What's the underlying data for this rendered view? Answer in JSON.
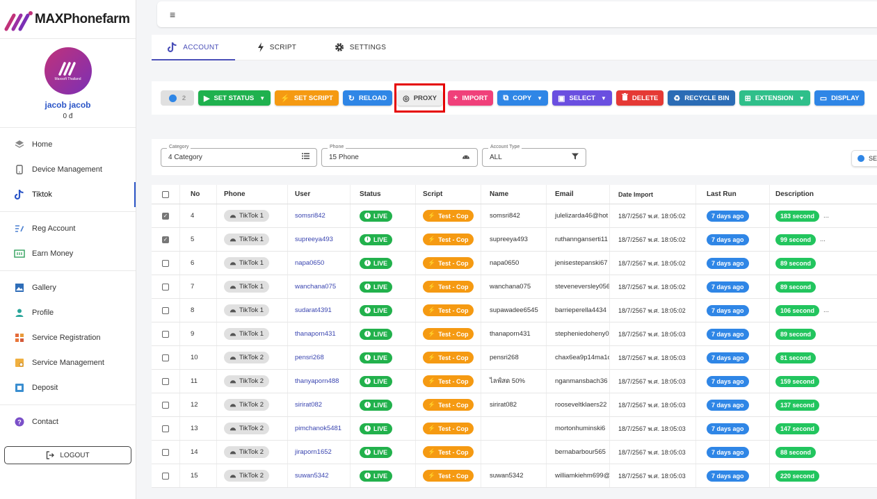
{
  "brand": {
    "name_prefix": "MAX",
    "name_suffix": "Phonefarm"
  },
  "profile": {
    "avatar_caption": "Maxsoft Thailand",
    "username": "jacob jacob",
    "balance": "0 đ"
  },
  "nav": {
    "groups": [
      [
        {
          "label": "Home",
          "icon": "layers-icon"
        },
        {
          "label": "Device Management",
          "icon": "device-icon"
        },
        {
          "label": "Tiktok",
          "icon": "tiktok-icon",
          "active": true
        }
      ],
      [
        {
          "label": "Reg Account",
          "icon": "reg-icon"
        },
        {
          "label": "Earn Money",
          "icon": "money-icon"
        }
      ],
      [
        {
          "label": "Gallery",
          "icon": "gallery-icon"
        },
        {
          "label": "Profile",
          "icon": "person-icon"
        },
        {
          "label": "Service Registration",
          "icon": "grid-icon"
        },
        {
          "label": "Service Management",
          "icon": "manage-icon"
        },
        {
          "label": "Deposit",
          "icon": "deposit-icon"
        }
      ],
      [
        {
          "label": "Contact",
          "icon": "help-icon"
        }
      ]
    ],
    "logout": "LOGOUT"
  },
  "topbar": {
    "menu_icon": "≡"
  },
  "tabs": [
    {
      "label": "ACCOUNT",
      "icon": "tiktok-icon"
    },
    {
      "label": "SCRIPT",
      "icon": "bolt-icon"
    },
    {
      "label": "SETTINGS",
      "icon": "gear-icon"
    }
  ],
  "toolbar": {
    "toggle_count": "2",
    "buttons": [
      {
        "label": "SET STATUS",
        "color": "#1fb14e",
        "icon": "▶",
        "caret": true
      },
      {
        "label": "SET SCRIPT",
        "color": "#f59a12",
        "icon": "⚡",
        "caret": false
      },
      {
        "label": "RELOAD",
        "color": "#2f86e6",
        "icon": "↻",
        "caret": false
      },
      {
        "label": "PROXY",
        "color": "#eeeeee",
        "icon": "◎",
        "caret": false
      },
      {
        "label": "IMPORT",
        "color": "#f0407a",
        "icon": "+",
        "caret": false
      },
      {
        "label": "COPY",
        "color": "#2f86e6",
        "icon": "⧉",
        "caret": true
      },
      {
        "label": "SELECT",
        "color": "#6a4fe0",
        "icon": "▣",
        "caret": true
      },
      {
        "label": "DELETE",
        "color": "#e53935",
        "icon": "🗑",
        "caret": false
      },
      {
        "label": "RECYCLE BIN",
        "color": "#2b6cb5",
        "icon": "♻",
        "caret": false
      },
      {
        "label": "EXTENSION",
        "color": "#2fbf8a",
        "icon": "⊞",
        "caret": true
      },
      {
        "label": "DISPLAY",
        "color": "#2f86e6",
        "icon": "▭",
        "caret": false
      }
    ]
  },
  "filters": {
    "category": {
      "label": "Category",
      "value": "4 Category"
    },
    "phone": {
      "label": "Phone",
      "value": "15 Phone"
    },
    "account_type": {
      "label": "Account Type",
      "value": "ALL"
    },
    "search_label": "SE"
  },
  "table": {
    "headers": [
      "No",
      "Phone",
      "User",
      "Status",
      "Script",
      "Name",
      "Email",
      "Date Import",
      "Last Run",
      "Description"
    ],
    "rows": [
      {
        "checked": true,
        "no": "4",
        "phone": "TikTok 1",
        "user": "somsri842",
        "status": "LIVE",
        "script": "Test - Cop",
        "name": "somsri842",
        "email": "julelizarda46@hot",
        "date": "18/7/2567 พ.ศ. 18:05:02",
        "last": "7 days ago",
        "desc": "183 second",
        "more": "..."
      },
      {
        "checked": true,
        "no": "5",
        "phone": "TikTok 1",
        "user": "supreeya493",
        "status": "LIVE",
        "script": "Test - Cop",
        "name": "supreeya493",
        "email": "ruthannganserti11",
        "date": "18/7/2567 พ.ศ. 18:05:02",
        "last": "7 days ago",
        "desc": "99 second",
        "more": "..."
      },
      {
        "checked": false,
        "no": "6",
        "phone": "TikTok 1",
        "user": "napa0650",
        "status": "LIVE",
        "script": "Test - Cop",
        "name": "napa0650",
        "email": "jenisestepanski67",
        "date": "18/7/2567 พ.ศ. 18:05:02",
        "last": "7 days ago",
        "desc": "89 second",
        "more": ""
      },
      {
        "checked": false,
        "no": "7",
        "phone": "TikTok 1",
        "user": "wanchana075",
        "status": "LIVE",
        "script": "Test - Cop",
        "name": "wanchana075",
        "email": "steveneversley056",
        "date": "18/7/2567 พ.ศ. 18:05:02",
        "last": "7 days ago",
        "desc": "89 second",
        "more": ""
      },
      {
        "checked": false,
        "no": "8",
        "phone": "TikTok 1",
        "user": "sudarat4391",
        "status": "LIVE",
        "script": "Test - Cop",
        "name": "supawadee6545",
        "email": "barrieperella4434",
        "date": "18/7/2567 พ.ศ. 18:05:02",
        "last": "7 days ago",
        "desc": "106 second",
        "more": "..."
      },
      {
        "checked": false,
        "no": "9",
        "phone": "TikTok 1",
        "user": "thanaporn431",
        "status": "LIVE",
        "script": "Test - Cop",
        "name": "thanaporn431",
        "email": "stepheniedoheny0",
        "date": "18/7/2567 พ.ศ. 18:05:03",
        "last": "7 days ago",
        "desc": "89 second",
        "more": ""
      },
      {
        "checked": false,
        "no": "10",
        "phone": "TikTok 2",
        "user": "pensri268",
        "status": "LIVE",
        "script": "Test - Cop",
        "name": "pensri268",
        "email": "chax6ea9p14ma1c",
        "date": "18/7/2567 พ.ศ. 18:05:03",
        "last": "7 days ago",
        "desc": "81 second",
        "more": ""
      },
      {
        "checked": false,
        "no": "11",
        "phone": "TikTok 2",
        "user": "thanyaporn488",
        "status": "LIVE",
        "script": "Test - Cop",
        "name": "ไลฟ์สด 50%",
        "email": "nganmansbach36",
        "date": "18/7/2567 พ.ศ. 18:05:03",
        "last": "7 days ago",
        "desc": "159 second",
        "more": ""
      },
      {
        "checked": false,
        "no": "12",
        "phone": "TikTok 2",
        "user": "sirirat082",
        "status": "LIVE",
        "script": "Test - Cop",
        "name": "sirirat082",
        "email": "rooseveltklaers22",
        "date": "18/7/2567 พ.ศ. 18:05:03",
        "last": "7 days ago",
        "desc": "137 second",
        "more": ""
      },
      {
        "checked": false,
        "no": "13",
        "phone": "TikTok 2",
        "user": "pimchanok5481",
        "status": "LIVE",
        "script": "Test - Cop",
        "name": "",
        "email": "mortonhuminski6",
        "date": "18/7/2567 พ.ศ. 18:05:03",
        "last": "7 days ago",
        "desc": "147 second",
        "more": ""
      },
      {
        "checked": false,
        "no": "14",
        "phone": "TikTok 2",
        "user": "jiraporn1652",
        "status": "LIVE",
        "script": "Test - Cop",
        "name": "",
        "email": "bernabarbour565",
        "date": "18/7/2567 พ.ศ. 18:05:03",
        "last": "7 days ago",
        "desc": "88 second",
        "more": ""
      },
      {
        "checked": false,
        "no": "15",
        "phone": "TikTok 2",
        "user": "suwan5342",
        "status": "LIVE",
        "script": "Test - Cop",
        "name": "suwan5342",
        "email": "williamkiehm699@",
        "date": "18/7/2567 พ.ศ. 18:05:03",
        "last": "7 days ago",
        "desc": "220 second",
        "more": ""
      }
    ]
  }
}
